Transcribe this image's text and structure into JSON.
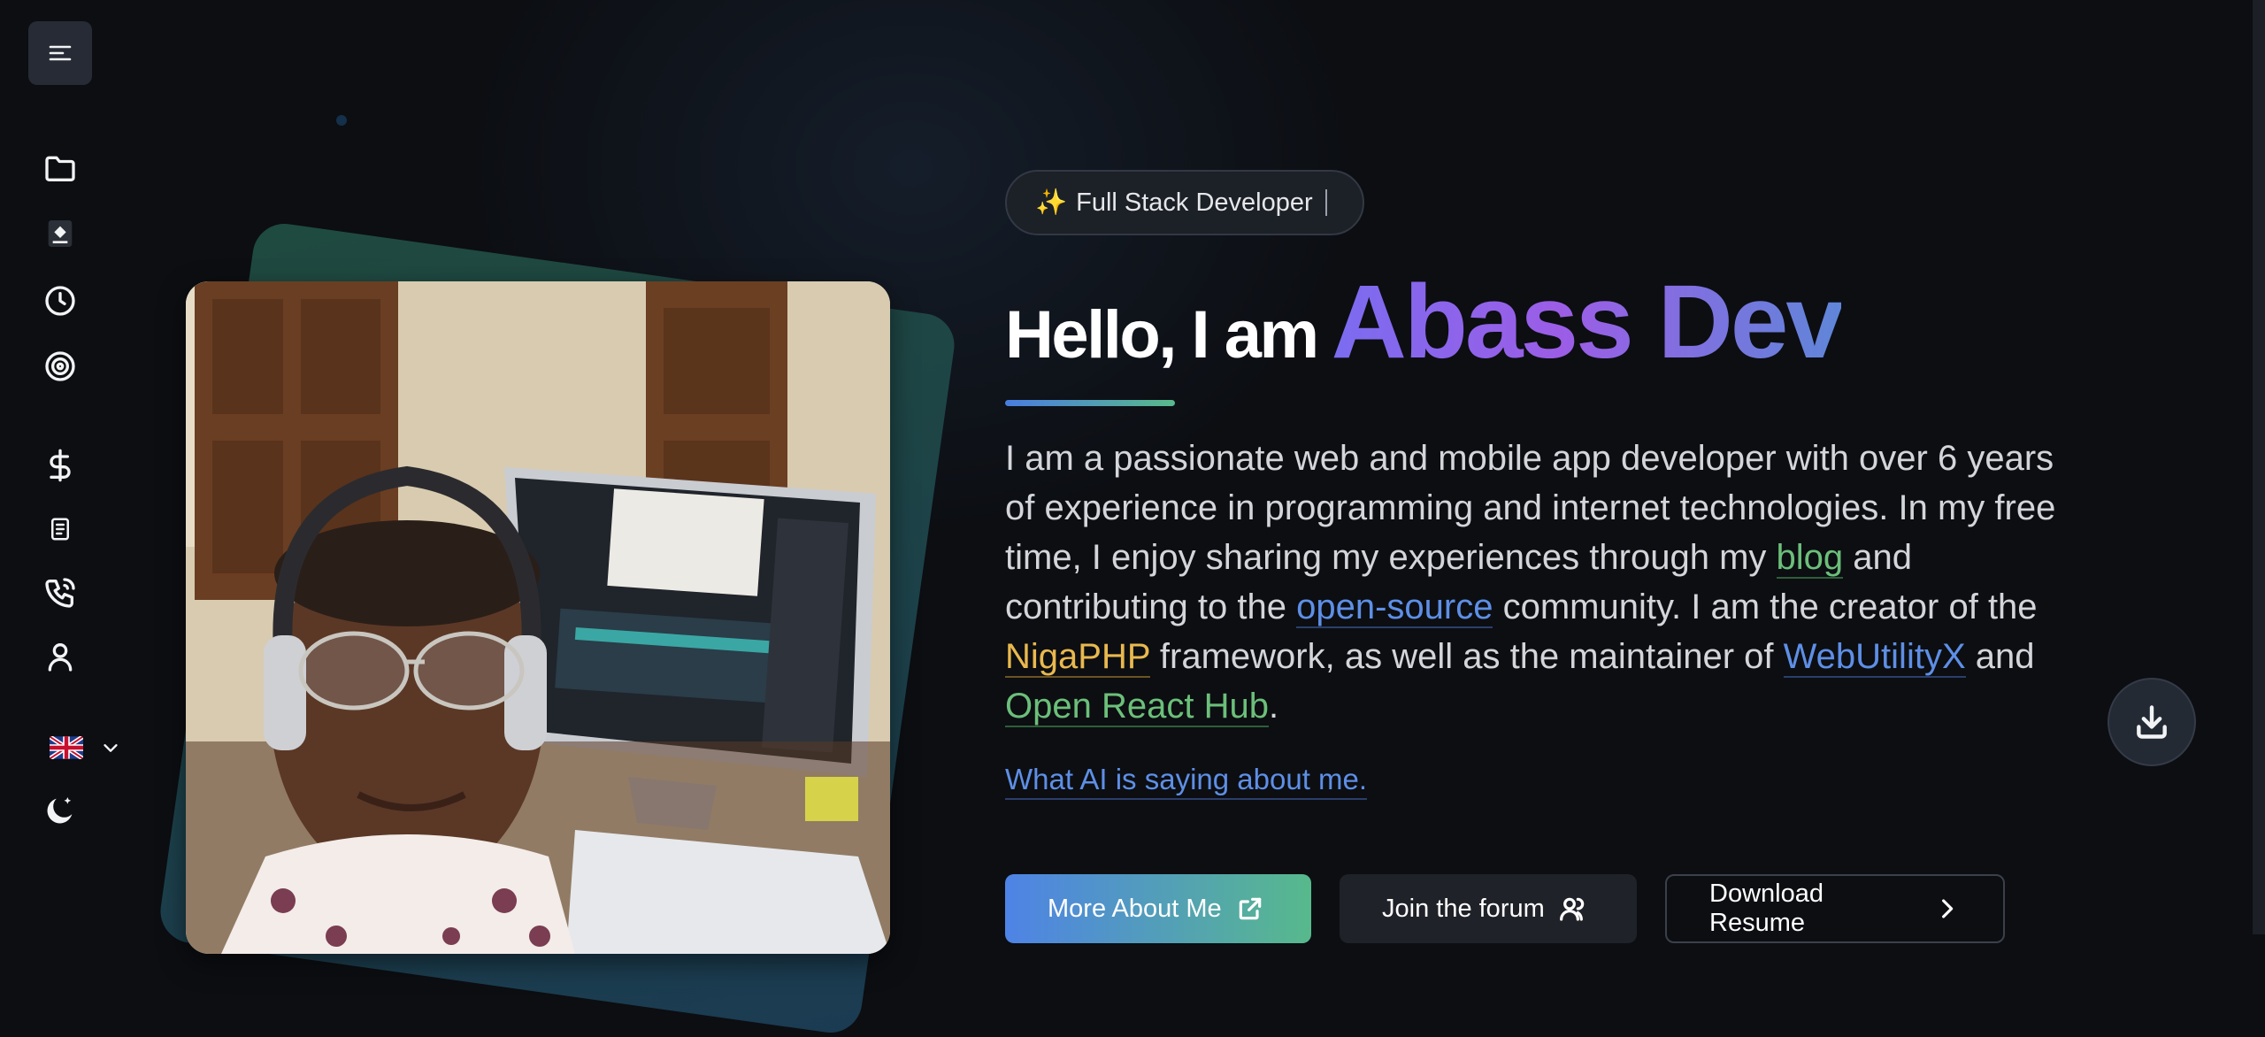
{
  "sidebar": {
    "menu_icon": "menu-icon",
    "items": [
      {
        "icon": "folder-icon",
        "label": "Projects"
      },
      {
        "icon": "blog-logo-icon",
        "label": "Blog"
      },
      {
        "icon": "clock-icon",
        "label": "History"
      },
      {
        "icon": "open-source-icon",
        "label": "Open source"
      },
      {
        "icon": "dollar-icon",
        "label": "Pricing"
      },
      {
        "icon": "document-icon",
        "label": "Resume"
      },
      {
        "icon": "phone-icon",
        "label": "Contact"
      },
      {
        "icon": "user-icon",
        "label": "About"
      }
    ],
    "language_flag": "uk-flag-icon",
    "theme_icon": "moon-icon"
  },
  "hero": {
    "badge_emoji": "✨",
    "badge": "Full Stack Developer",
    "greeting": "Hello, I am",
    "name": "Abass Dev",
    "bio": {
      "p1": "I am a passionate web and mobile app developer with over 6 years of experience in programming and internet technologies. In my free time, I enjoy sharing my experiences through my ",
      "link_blog": "blog",
      "p2": " and contributing to the ",
      "link_open_source": "open-source",
      "p3": " community. I am the creator of the ",
      "link_nigaphp": "NigaPHP",
      "p4": " framework, as well as the maintainer of ",
      "link_webutilityx": "WebUtilityX",
      "p5": " and ",
      "link_open_react_hub": "Open React Hub",
      "p6": "."
    },
    "ai_link": "What AI is saying about me.",
    "buttons": {
      "more": "More About Me",
      "forum": "Join the forum",
      "resume": "Download Resume"
    }
  },
  "colors": {
    "background": "#0c0e12",
    "accent_purple": "#9c5de6",
    "accent_blue": "#5e8fe6",
    "accent_green": "#6cbf7a",
    "accent_yellow": "#e9b84e"
  }
}
